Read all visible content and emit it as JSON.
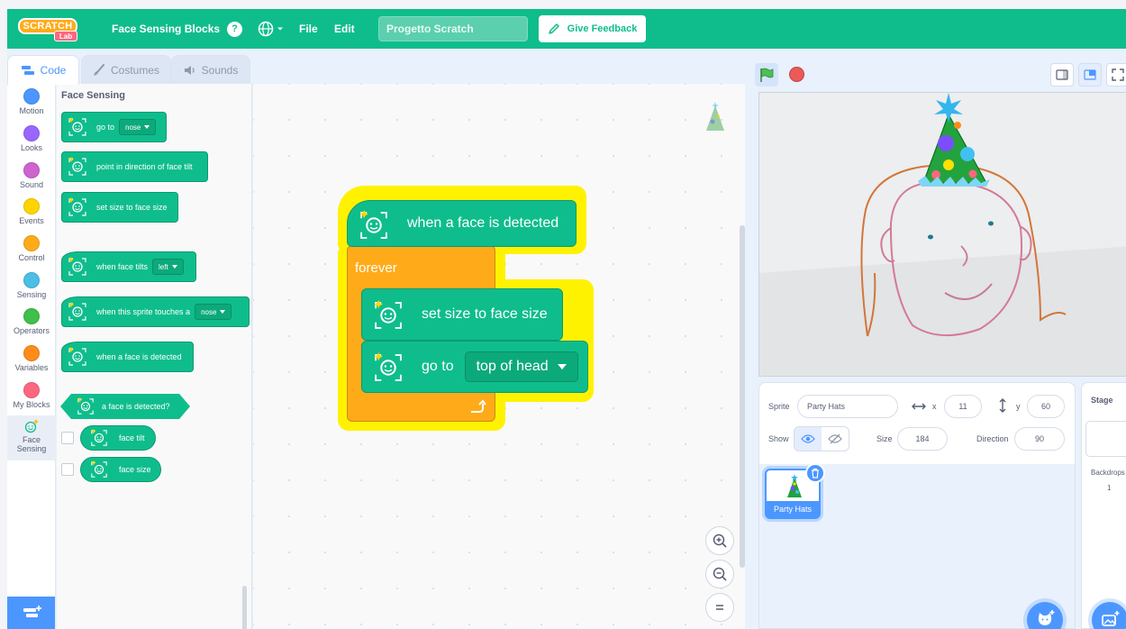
{
  "menubar": {
    "logo_text": "SCRATCH",
    "logo_badge": "Lab",
    "title": "Face Sensing Blocks",
    "help": "?",
    "file": "File",
    "edit": "Edit",
    "project_name": "Progetto Scratch",
    "feedback": "Give Feedback"
  },
  "tabs": {
    "code": "Code",
    "costumes": "Costumes",
    "sounds": "Sounds"
  },
  "categories": [
    {
      "label": "Motion",
      "color": "#4c97ff"
    },
    {
      "label": "Looks",
      "color": "#9966ff"
    },
    {
      "label": "Sound",
      "color": "#cf63cf"
    },
    {
      "label": "Events",
      "color": "#ffd500"
    },
    {
      "label": "Control",
      "color": "#ffab19"
    },
    {
      "label": "Sensing",
      "color": "#4cbfe6"
    },
    {
      "label": "Operators",
      "color": "#40bf4a"
    },
    {
      "label": "Variables",
      "color": "#ff8c1a"
    },
    {
      "label": "My Blocks",
      "color": "#ff6680"
    },
    {
      "label": "Face Sensing",
      "color": "#0fbd8c"
    }
  ],
  "palette": {
    "title": "Face Sensing",
    "go_to": "go to",
    "go_to_value": "nose",
    "point_dir": "point in direction of face tilt",
    "set_size": "set size to face size",
    "when_tilts": "when face tilts",
    "when_tilts_value": "left",
    "when_touches": "when this sprite touches a",
    "when_touches_value": "nose",
    "when_detected": "when a face is detected",
    "is_detected": "a face is detected?",
    "face_tilt": "face tilt",
    "face_size": "face size"
  },
  "script": {
    "hat": "when a face is detected",
    "forever": "forever",
    "set_size": "set size to face size",
    "go_to": "go to",
    "go_to_value": "top of head"
  },
  "sprite": {
    "label": "Sprite",
    "name": "Party Hats",
    "x_label": "x",
    "x": "11",
    "y_label": "y",
    "y": "60",
    "show_label": "Show",
    "size_label": "Size",
    "size": "184",
    "direction_label": "Direction",
    "direction": "90",
    "thumb_name": "Party Hats"
  },
  "stage_panel": {
    "title": "Stage",
    "backdrops_label": "Backdrops",
    "backdrops_count": "1"
  },
  "colors": {
    "menubar": "#0fbd8c",
    "face_block": "#0fbd8c",
    "control": "#ffab19",
    "accent": "#4c97ff",
    "highlight": "#fff200"
  }
}
